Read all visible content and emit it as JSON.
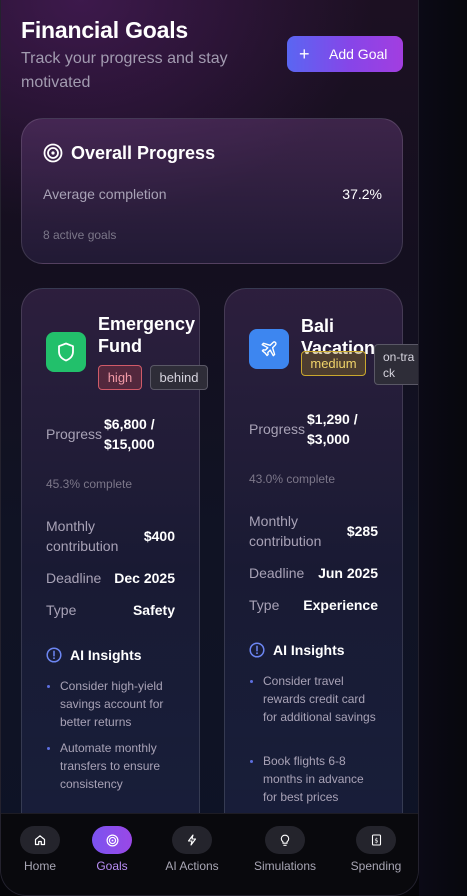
{
  "header": {
    "title": "Financial Goals",
    "subtitle": "Track your progress and stay motivated",
    "add_button_label": "Add Goal"
  },
  "overall": {
    "heading": "Overall Progress",
    "avg_label": "Average completion",
    "avg_value": "37.2%",
    "active_goals": "8 active goals"
  },
  "goals": [
    {
      "name": "Emergency Fund",
      "priority": "high",
      "status": "behind",
      "progress_label": "Progress",
      "progress_value": "$6,800 / $15,000",
      "percent_text": "45.3% complete",
      "monthly_label": "Monthly contribution",
      "monthly_value": "$400",
      "deadline_label": "Deadline",
      "deadline_value": "Dec 2025",
      "type_label": "Type",
      "type_value": "Safety",
      "ai_heading": "AI Insights",
      "insights": [
        "Consider high-yield savings account for better returns",
        "Automate monthly transfers to ensure consistency"
      ],
      "icon": "shield-icon",
      "color": "#22c06b"
    },
    {
      "name": "Bali Vacation",
      "priority": "medium",
      "status": "on-track",
      "progress_label": "Progress",
      "progress_value": "$1,290 / $3,000",
      "percent_text": "43.0% complete",
      "monthly_label": "Monthly contribution",
      "monthly_value": "$285",
      "deadline_label": "Deadline",
      "deadline_value": "Jun 2025",
      "type_label": "Type",
      "type_value": "Experience",
      "ai_heading": "AI Insights",
      "insights": [
        "Consider travel rewards credit card for additional savings",
        "Book flights 6-8 months in advance for best prices"
      ],
      "icon": "plane-icon",
      "color": "#3d86f0"
    }
  ],
  "tabs": [
    {
      "label": "Home",
      "icon": "home-icon"
    },
    {
      "label": "Goals",
      "icon": "target-icon",
      "active": true
    },
    {
      "label": "AI Actions",
      "icon": "bolt-icon"
    },
    {
      "label": "Simulations",
      "icon": "lightbulb-icon"
    },
    {
      "label": "Spending",
      "icon": "receipt-icon"
    }
  ]
}
